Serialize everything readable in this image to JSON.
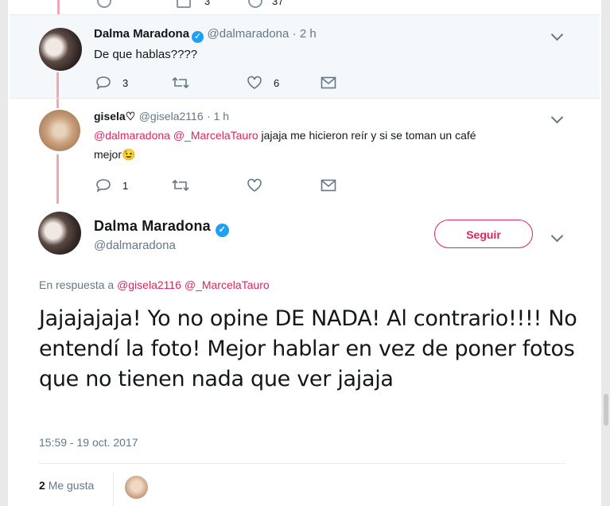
{
  "tweets": [
    {
      "name": "Dalma Maradona",
      "handle": "@dalmaradona",
      "time": "· 2 h",
      "text": "De que hablas????",
      "replies": "3",
      "likes": "6"
    },
    {
      "name": "gisela♡",
      "handle": "@gisela2116",
      "time": "· 1 h",
      "mention1": "@dalmaradona",
      "mention2": "@_MarcelaTauro",
      "text_line1": "jajaja me hicieron reír y si se toman un café",
      "text_line2": "mejor😉",
      "replies": "1"
    }
  ],
  "main": {
    "name": "Dalma Maradona",
    "handle": "@dalmaradona",
    "follow_label": "Seguir",
    "reply_prefix": "En respuesta a",
    "reply_mention1": "@gisela2116",
    "reply_mention2": "@_MarcelaTauro",
    "text": "Jajajajaja! Yo no opine DE NADA! Al contrario!!!!  No entendí la foto! Mejor hablar en vez de poner fotos que no tienen nada que ver jajaja",
    "timestamp": "15:59 - 19 oct. 2017",
    "like_count": "2",
    "like_label": "Me gusta"
  },
  "top_partial": {
    "counts": [
      "3",
      "37"
    ]
  },
  "colors": {
    "accent": "#e0245e",
    "verified": "#1da1f2",
    "thread_line": "#f4a6b1",
    "muted": "#657786"
  },
  "icons": [
    "reply-icon",
    "retweet-icon",
    "like-icon",
    "message-icon",
    "verified-icon",
    "chevron-down-icon"
  ]
}
